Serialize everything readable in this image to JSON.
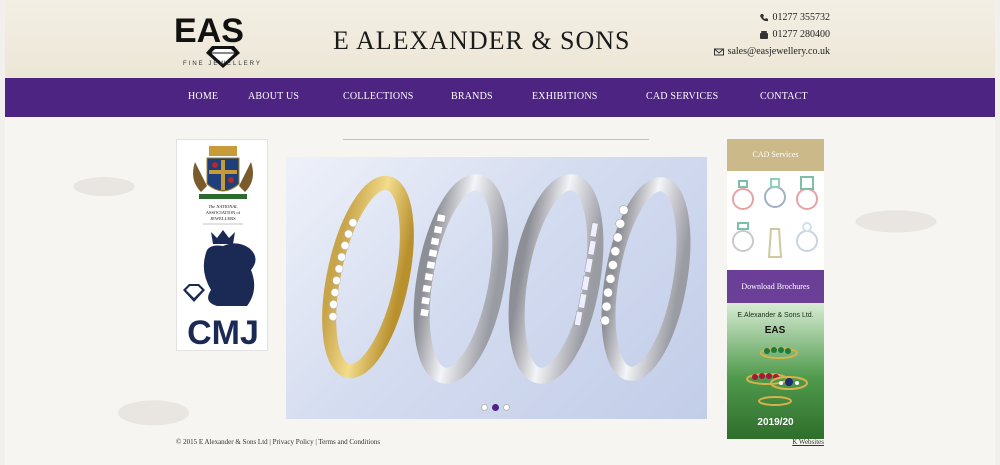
{
  "header": {
    "logo_text": "EAS",
    "logo_tagline": "FINE JEWELLERY",
    "site_title": "E ALEXANDER & SONS",
    "phone_1": "01277 355732",
    "phone_2": "01277 280400",
    "email": "sales@easjewellery.co.uk"
  },
  "nav": {
    "items": [
      "HOME",
      "ABOUT US",
      "COLLECTIONS",
      "BRANDS",
      "EXHIBITIONS",
      "CAD SERVICES",
      "CONTACT"
    ]
  },
  "left_panel": {
    "naj_text_1": "The NATIONAL",
    "naj_text_2": "ASSOCIATION of",
    "naj_text_3": "JEWELLERS",
    "cmj_text": "CMJ"
  },
  "slider": {
    "slide_count": 3,
    "active_index": 1
  },
  "right_panel": {
    "cad_heading": "CAD Services",
    "download_heading": "Download Brochures",
    "brochure_title": "E.Alexander & Sons Ltd.",
    "brochure_logo": "EAS",
    "brochure_year": "2019/20"
  },
  "footer": {
    "copyright": "© 2015 E Alexander & Sons Ltd",
    "privacy": "Privacy Policy",
    "terms": "Terms and Conditions",
    "credit": "K Websites"
  },
  "colors": {
    "nav_purple": "#4e2483",
    "gold_header": "#cbb98a",
    "download_purple": "#6b3f97"
  }
}
